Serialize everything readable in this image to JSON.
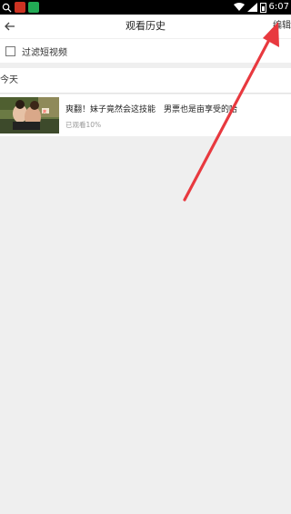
{
  "status_bar": {
    "time": "6:07",
    "app_colors": [
      "#cc3322",
      "#22aa55"
    ]
  },
  "header": {
    "back_icon": "arrow-left-icon",
    "title": "观看历史",
    "edit_label": "编辑"
  },
  "filter": {
    "checked": false,
    "label": "过滤短视频"
  },
  "sections": [
    {
      "title": "今天",
      "items": [
        {
          "title": "爽翻！妹子竟然会这技能　男票也是亩享受的哈",
          "progress": "已观看10%"
        }
      ]
    }
  ],
  "annotation": {
    "arrow_color": "#e8393f"
  }
}
